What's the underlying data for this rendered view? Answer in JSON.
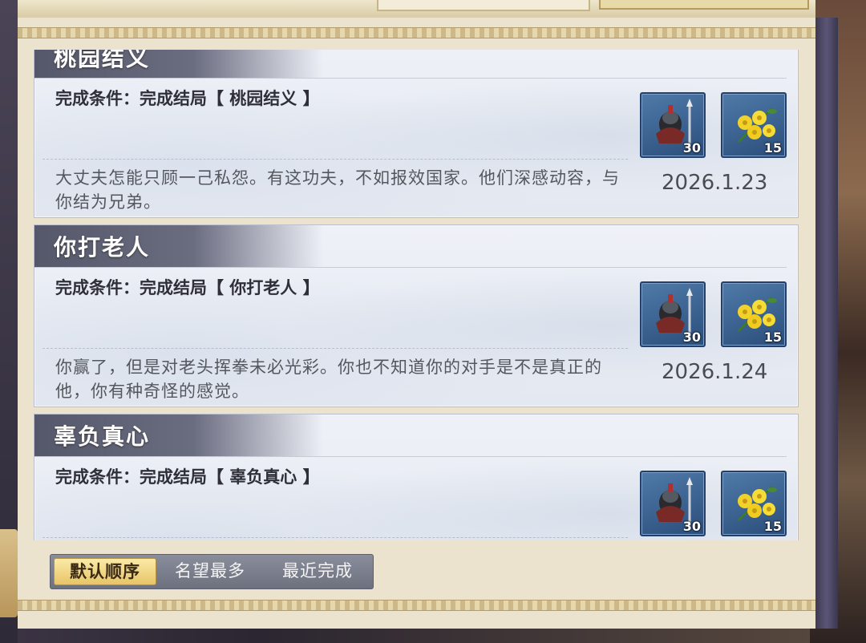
{
  "achievements": [
    {
      "title": "桃园结义",
      "condition": "完成条件：完成结局【 桃园结义 】",
      "description": "大丈夫怎能只顾一己私怨。有这功夫，不如报效国家。他们深感动容，与你结为兄弟。",
      "date": "2026.1.23",
      "rewards": [
        {
          "icon": "helmet-icon",
          "qty": "30"
        },
        {
          "icon": "yellow-flower-icon",
          "qty": "15"
        }
      ]
    },
    {
      "title": "你打老人",
      "condition": "完成条件：完成结局【 你打老人 】",
      "description": "你赢了，但是对老头挥拳未必光彩。你也不知道你的对手是不是真正的他，你有种奇怪的感觉。",
      "date": "2026.1.24",
      "rewards": [
        {
          "icon": "helmet-icon",
          "qty": "30"
        },
        {
          "icon": "yellow-flower-icon",
          "qty": "15"
        }
      ]
    },
    {
      "title": "辜负真心",
      "condition": "完成条件：完成结局【 辜负真心 】",
      "description": "",
      "date": "",
      "rewards": [
        {
          "icon": "helmet-icon",
          "qty": "30"
        },
        {
          "icon": "yellow-flower-icon",
          "qty": "15"
        }
      ]
    }
  ],
  "sort": {
    "options": [
      "默认顺序",
      "名望最多",
      "最近完成"
    ],
    "selected": "默认顺序"
  }
}
